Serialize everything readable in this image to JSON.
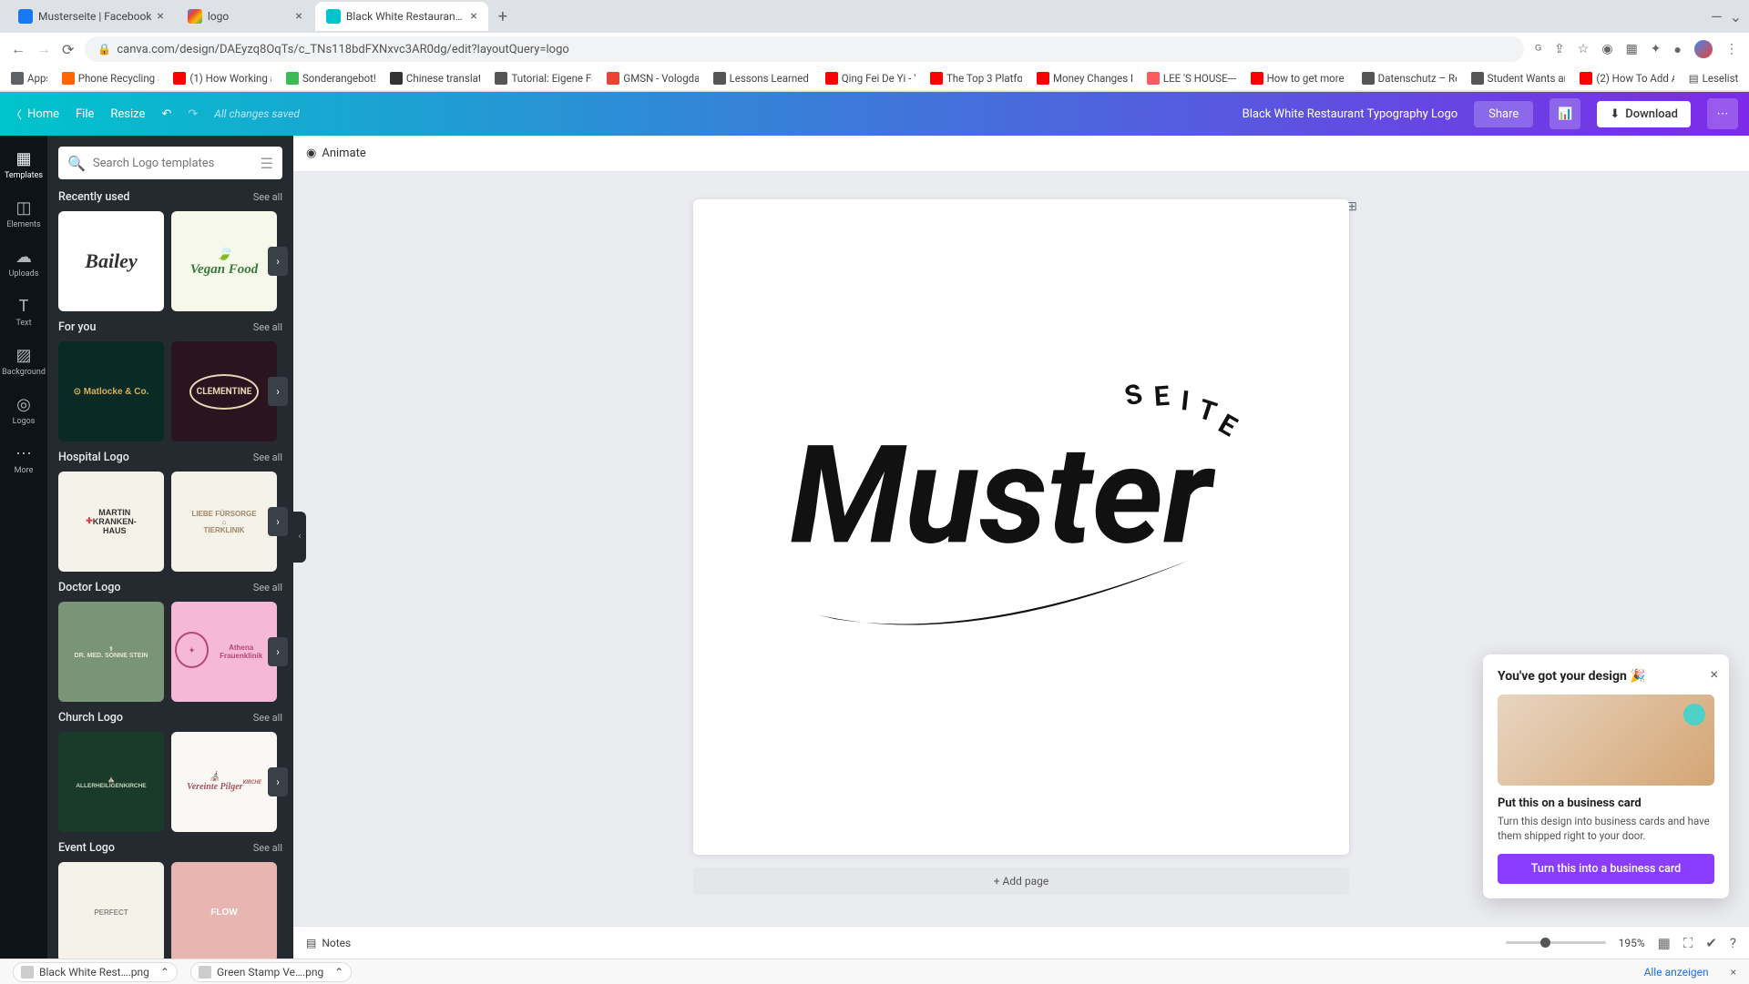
{
  "browser": {
    "tabs": [
      {
        "title": "Musterseite | Facebook",
        "fav_color": "#1877f2"
      },
      {
        "title": "logo",
        "fav_color": "#4285f4"
      },
      {
        "title": "Black White Restaurant Typo…",
        "fav_color": "#00c4cc"
      }
    ],
    "url": "canva.com/design/DAEyzq8OqTs/c_TNs118bdFXNxvc3AR0dg/edit?layoutQuery=logo",
    "bookmarks": [
      {
        "label": "Apps",
        "color": "#5f6368"
      },
      {
        "label": "Phone Recycling a…",
        "color": "#ff6600"
      },
      {
        "label": "(1) How Working a…",
        "color": "#ff0000"
      },
      {
        "label": "Sonderangebot! …",
        "color": "#3cba54"
      },
      {
        "label": "Chinese translati…",
        "color": "#333"
      },
      {
        "label": "Tutorial: Eigene Fa…",
        "color": "#555"
      },
      {
        "label": "GMSN - Vologda,…",
        "color": "#ea4335"
      },
      {
        "label": "Lessons Learned f…",
        "color": "#555"
      },
      {
        "label": "Qing Fei De Yi - Y…",
        "color": "#ff0000"
      },
      {
        "label": "The Top 3 Platfor…",
        "color": "#ff0000"
      },
      {
        "label": "Money Changes E…",
        "color": "#ff0000"
      },
      {
        "label": "LEE 'S HOUSE----…",
        "color": "#ff5a5f"
      },
      {
        "label": "How to get more v…",
        "color": "#ff0000"
      },
      {
        "label": "Datenschutz – Re…",
        "color": "#555"
      },
      {
        "label": "Student Wants an…",
        "color": "#555"
      },
      {
        "label": "(2) How To Add A…",
        "color": "#ff0000"
      }
    ],
    "reading_list": "Leseliste"
  },
  "canva_top": {
    "home": "Home",
    "file": "File",
    "resize": "Resize",
    "status": "All changes saved",
    "doc_title": "Black White Restaurant Typography Logo",
    "share": "Share",
    "download": "Download"
  },
  "rail": [
    {
      "label": "Templates"
    },
    {
      "label": "Elements"
    },
    {
      "label": "Uploads"
    },
    {
      "label": "Text"
    },
    {
      "label": "Background"
    },
    {
      "label": "Logos"
    },
    {
      "label": "More"
    }
  ],
  "search": {
    "placeholder": "Search Logo templates"
  },
  "sections": {
    "recently_used": {
      "title": "Recently used",
      "see_all": "See all",
      "items": [
        {
          "text": "Bailey",
          "bg": "#ffffff",
          "color": "#222",
          "font": "italic 700 20px cursive"
        },
        {
          "text": "Vegan Food",
          "bg": "#f6f9ea",
          "color": "#3a7a3a",
          "font": "italic 700 14px cursive"
        }
      ]
    },
    "for_you": {
      "title": "For you",
      "see_all": "See all",
      "items": [
        {
          "text": "Matlocke & Co.",
          "bg": "#0a2a26",
          "color": "#d8b05a",
          "font": "600 10px sans-serif"
        },
        {
          "text": "CLEMENTINE",
          "bg": "#2a1420",
          "color": "#e8d5b5",
          "font": "700 10px serif"
        }
      ]
    },
    "hospital": {
      "title": "Hospital Logo",
      "see_all": "See all",
      "items": [
        {
          "text": "MARTIN\nKRANKEN-\nHAUS",
          "bg": "#f5f2ea",
          "color": "#333",
          "font": "700 9px sans-serif"
        },
        {
          "text": "LIEBE FÜRSORGE\nTIERKLINIK",
          "bg": "#f5f2ea",
          "color": "#a08565",
          "font": "600 8px sans-serif"
        }
      ]
    },
    "doctor": {
      "title": "Doctor Logo",
      "see_all": "See all",
      "items": [
        {
          "text": "DR. MED. SONNE STEIN",
          "bg": "#7a9478",
          "color": "#e8e4d8",
          "font": "600 7px sans-serif"
        },
        {
          "text": "Athena Frauenklinik",
          "bg": "#f5b8d6",
          "color": "#b5487a",
          "font": "600 8px sans-serif"
        }
      ]
    },
    "church": {
      "title": "Church Logo",
      "see_all": "See all",
      "items": [
        {
          "text": "ALLERHEILIGENKIRCHE",
          "bg": "#1a3a2a",
          "color": "#c8d5c0",
          "font": "600 7px sans-serif"
        },
        {
          "text": "Vereinte Pilger\nKIRCHE",
          "bg": "#faf8f4",
          "color": "#a5555a",
          "font": "italic 600 9px serif"
        }
      ]
    },
    "event": {
      "title": "Event Logo",
      "see_all": "See all",
      "items": [
        {
          "text": "PERFECT",
          "bg": "#f5f2ea",
          "color": "#888",
          "font": "600 8px sans-serif"
        },
        {
          "text": "FLOW",
          "bg": "#e8b5b0",
          "color": "#fff",
          "font": "700 10px sans-serif"
        }
      ]
    }
  },
  "canvas": {
    "animate": "Animate",
    "curved_text": "SEITE",
    "main_text": "Muster",
    "add_page": "+ Add page"
  },
  "bottom": {
    "notes": "Notes",
    "zoom": "195%"
  },
  "promo": {
    "title": "You've got your design 🎉",
    "subtitle": "Put this on a business card",
    "desc": "Turn this design into business cards and have them shipped right to your door.",
    "cta": "Turn this into a business card"
  },
  "downloads": {
    "items": [
      {
        "name": "Black White Rest….png"
      },
      {
        "name": "Green Stamp Ve….png"
      }
    ],
    "show_all": "Alle anzeigen"
  }
}
